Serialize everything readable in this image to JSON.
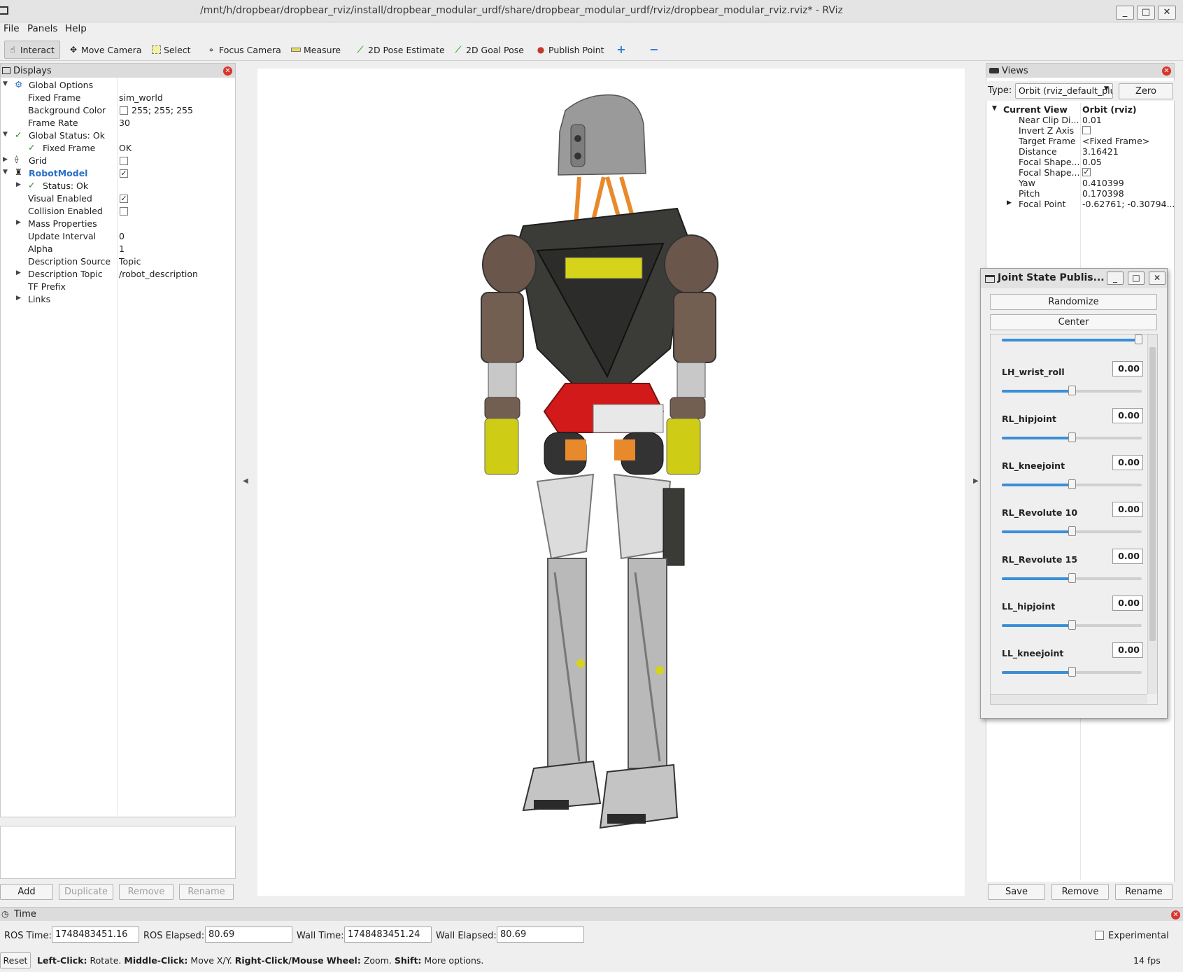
{
  "window": {
    "title": "/mnt/h/dropbear/dropbear_rviz/install/dropbear_modular_urdf/share/dropbear_modular_urdf/rviz/dropbear_modular_rviz.rviz* - RViz",
    "minimize": "_",
    "maximize": "□",
    "close": "✕"
  },
  "menu": [
    "File",
    "Panels",
    "Help"
  ],
  "toolbar": [
    {
      "label": "Interact",
      "icon": "hand-icon"
    },
    {
      "label": "Move Camera",
      "icon": "move-camera-icon"
    },
    {
      "label": "Select",
      "icon": "select-icon"
    },
    {
      "label": "Focus Camera",
      "icon": "focus-camera-icon"
    },
    {
      "label": "Measure",
      "icon": "measure-icon"
    },
    {
      "label": "2D Pose Estimate",
      "icon": "green-arrow-icon"
    },
    {
      "label": "2D Goal Pose",
      "icon": "green-arrow-icon"
    },
    {
      "label": "Publish Point",
      "icon": "pin-icon"
    }
  ],
  "displays": {
    "title": "Displays",
    "rows": {
      "global_options": "Global Options",
      "fixed_frame": {
        "label": "Fixed Frame",
        "value": "sim_world"
      },
      "background_color": {
        "label": "Background Color",
        "value": "255; 255; 255"
      },
      "frame_rate": {
        "label": "Frame Rate",
        "value": "30"
      },
      "global_status": "Global Status: Ok",
      "status_fixed_frame": {
        "label": "Fixed Frame",
        "value": "OK"
      },
      "grid": "Grid",
      "robot_model": "RobotModel",
      "status_ok": "Status: Ok",
      "visual_enabled": "Visual Enabled",
      "collision_enabled": "Collision Enabled",
      "mass_properties": "Mass Properties",
      "update_interval": {
        "label": "Update Interval",
        "value": "0"
      },
      "alpha": {
        "label": "Alpha",
        "value": "1"
      },
      "description_source": {
        "label": "Description Source",
        "value": "Topic"
      },
      "description_topic": {
        "label": "Description Topic",
        "value": "/robot_description"
      },
      "tf_prefix": "TF Prefix",
      "links": "Links"
    },
    "buttons": {
      "add": "Add",
      "duplicate": "Duplicate",
      "remove": "Remove",
      "rename": "Rename"
    }
  },
  "views": {
    "title": "Views",
    "type_label": "Type:",
    "type_value": "Orbit (rviz_default_plugins)",
    "zero": "Zero",
    "current_view": {
      "label": "Current View",
      "value": "Orbit (rviz)"
    },
    "rows": {
      "near_clip": {
        "label": "Near Clip Di...",
        "value": "0.01"
      },
      "invert_z": {
        "label": "Invert Z Axis"
      },
      "target_frame": {
        "label": "Target Frame",
        "value": "<Fixed Frame>"
      },
      "distance": {
        "label": "Distance",
        "value": "3.16421"
      },
      "focal_shape_size": {
        "label": "Focal Shape...",
        "value": "0.05"
      },
      "focal_shape_fixed": {
        "label": "Focal Shape..."
      },
      "yaw": {
        "label": "Yaw",
        "value": "0.410399"
      },
      "pitch": {
        "label": "Pitch",
        "value": "0.170398"
      },
      "focal_point": {
        "label": "Focal Point",
        "value": "-0.62761; -0.30794..."
      }
    },
    "buttons": {
      "save": "Save",
      "remove": "Remove",
      "rename": "Rename"
    }
  },
  "joint_state_publisher": {
    "title": "Joint State Publis...",
    "randomize": "Randomize",
    "center": "Center",
    "joints": [
      {
        "name": "LH_wrist_roll",
        "value": "0.00",
        "position": 0.5
      },
      {
        "name": "RL_hipjoint",
        "value": "0.00",
        "position": 0.5
      },
      {
        "name": "RL_kneejoint",
        "value": "0.00",
        "position": 0.5
      },
      {
        "name": "RL_Revolute 10",
        "value": "0.00",
        "position": 0.5
      },
      {
        "name": "RL_Revolute 15",
        "value": "0.00",
        "position": 0.5
      },
      {
        "name": "LL_hipjoint",
        "value": "0.00",
        "position": 0.5
      },
      {
        "name": "LL_kneejoint",
        "value": "0.00",
        "position": 0.5
      }
    ]
  },
  "time": {
    "title": "Time",
    "ros_time": {
      "label": "ROS Time:",
      "value": "1748483451.16"
    },
    "ros_elapsed": {
      "label": "ROS Elapsed:",
      "value": "80.69"
    },
    "wall_time": {
      "label": "Wall Time:",
      "value": "1748483451.24"
    },
    "wall_elapsed": {
      "label": "Wall Elapsed:",
      "value": "80.69"
    },
    "experimental": "Experimental"
  },
  "status": {
    "reset": "Reset",
    "left_click": "Left-Click:",
    "left_click_desc": "Rotate.",
    "middle_click": "Middle-Click:",
    "middle_click_desc": "Move X/Y.",
    "right_click": "Right-Click/Mouse Wheel:",
    "right_click_desc": "Zoom.",
    "shift": "Shift:",
    "shift_desc": "More options.",
    "fps": "14 fps"
  }
}
